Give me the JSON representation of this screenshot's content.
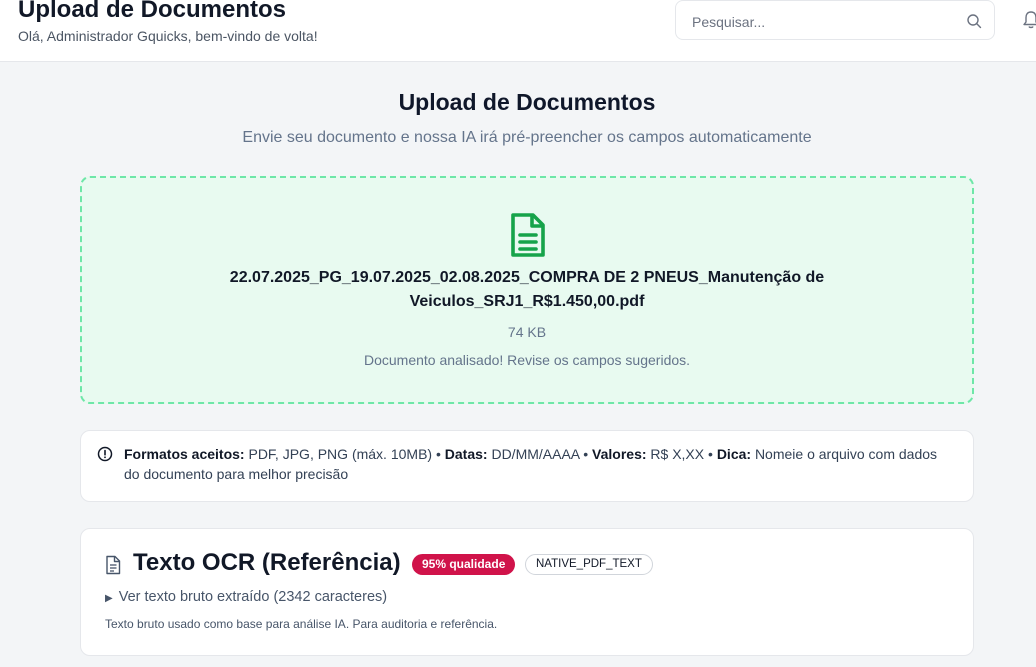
{
  "header": {
    "title": "Upload de Documentos",
    "subtitle": "Olá, Administrador Gquicks, bem-vindo de volta!",
    "search_placeholder": "Pesquisar...",
    "search_icon": "search-icon",
    "bell_icon": "bell-icon"
  },
  "main": {
    "title": "Upload de Documentos",
    "subtitle": "Envie seu documento e nossa IA irá pré-preencher os campos automaticamente"
  },
  "upload": {
    "icon": "document-icon",
    "filename": "22.07.2025_PG_19.07.2025_02.08.2025_COMPRA DE 2 PNEUS_Manutenção de Veiculos_SRJ1_R$1.450,00.pdf",
    "filesize": "74 KB",
    "status": "Documento analisado! Revise os campos sugeridos.",
    "colors": {
      "background": "#e8faf0",
      "border": "#6ee7a8",
      "icon": "#16a34a"
    }
  },
  "info": {
    "icon": "info-circle-icon",
    "formats_label": "Formatos aceitos:",
    "formats_value": "PDF, JPG, PNG (máx. 10MB)",
    "dates_label": "Datas:",
    "dates_value": "DD/MM/AAAA",
    "values_label": "Valores:",
    "values_value": "R$ X,XX",
    "tip_label": "Dica:",
    "tip_value": "Nomeie o arquivo com dados do documento para melhor precisão",
    "separator": "•"
  },
  "ocr": {
    "icon": "file-text-icon",
    "title": "Texto OCR (Referência)",
    "quality_badge": "95% qualidade",
    "method_badge": "NATIVE_PDF_TEXT",
    "toggle_label": "Ver texto bruto extraído (2342 caracteres)",
    "note": "Texto bruto usado como base para análise IA. Para auditoria e referência.",
    "colors": {
      "quality_badge": "#d0134a"
    }
  }
}
